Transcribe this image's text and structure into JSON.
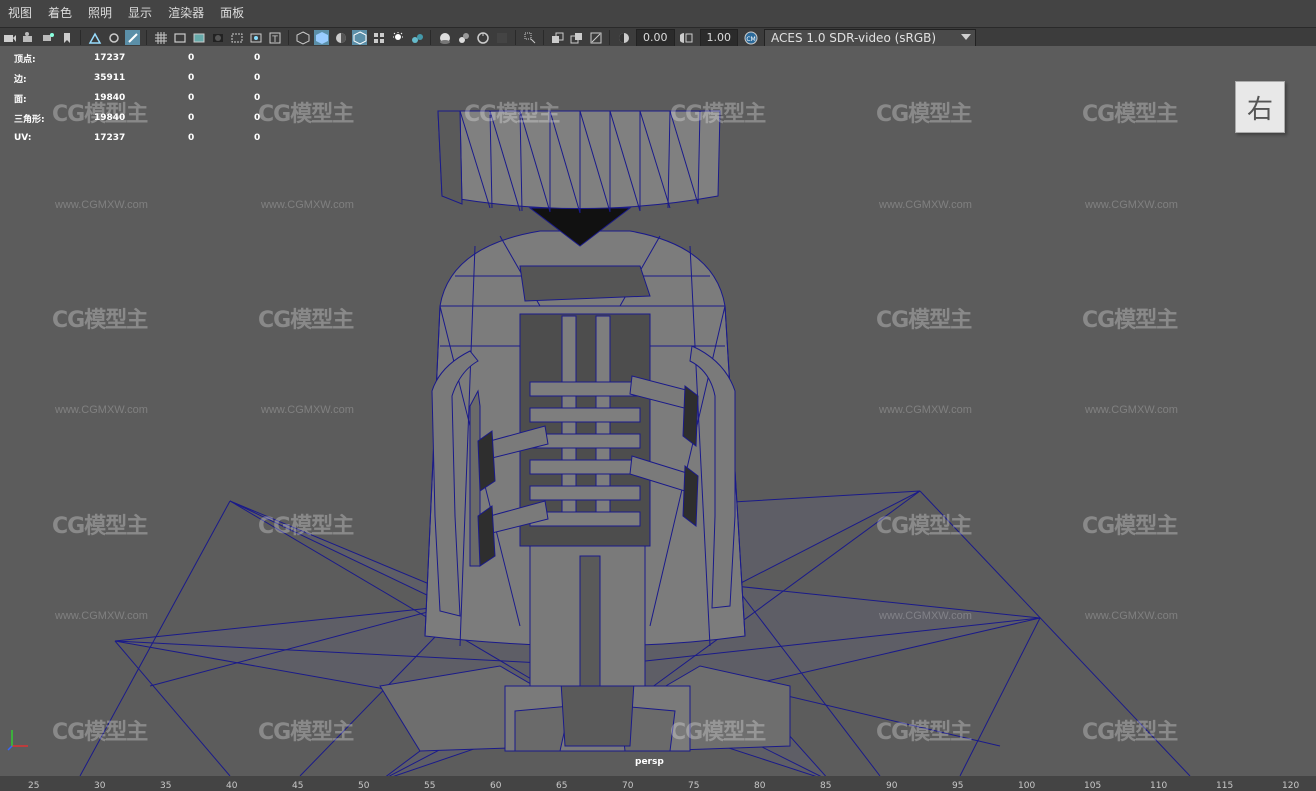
{
  "menu": [
    "视图",
    "着色",
    "照明",
    "显示",
    "渲染器",
    "面板"
  ],
  "toolbar": {
    "exposure_value": "0.00",
    "gamma_value": "1.00",
    "color_space": "ACES 1.0 SDR-video (sRGB)",
    "icons": [
      "camera-icon",
      "camera-attr-icon",
      "bookmark-icon",
      "image-plane-icon",
      "grid-icon",
      "film-gate-icon",
      "resolution-gate-icon",
      "gate-mask-icon",
      "field-chart-icon",
      "safe-action-icon",
      "safe-title-icon",
      "wireframe-icon",
      "smooth-shade-icon",
      "default-material-icon",
      "wireframe-on-shaded-icon",
      "textured-icon",
      "lights-icon",
      "shadows-icon",
      "ambient-occlusion-icon",
      "motion-blur-icon",
      "anti-alias-icon",
      "depth-of-field-icon",
      "isolate-select-icon",
      "xray-icon",
      "xray-joints-icon",
      "backface-icon",
      "exposure-icon",
      "gamma-icon",
      "color-mgmt-icon"
    ]
  },
  "hud": {
    "rows": [
      {
        "label": "顶点:",
        "value": "17237",
        "sel": "0",
        "comp": "0"
      },
      {
        "label": "边:",
        "value": "35911",
        "sel": "0",
        "comp": "0"
      },
      {
        "label": "面:",
        "value": "19840",
        "sel": "0",
        "comp": "0"
      },
      {
        "label": "三角形:",
        "value": "19840",
        "sel": "0",
        "comp": "0"
      },
      {
        "label": "UV:",
        "value": "17237",
        "sel": "0",
        "comp": "0"
      }
    ]
  },
  "viewcube_label": "右",
  "camera_label": "persp",
  "watermark": {
    "brand": "CG模型主",
    "url": "www.CGMXW.com"
  },
  "ruler_ticks": [
    "25",
    "30",
    "35",
    "40",
    "45",
    "50",
    "55",
    "60",
    "65",
    "70",
    "75",
    "80",
    "85",
    "90",
    "95",
    "100",
    "105",
    "110",
    "115",
    "120"
  ],
  "colors": {
    "wire": "#1a1a8a",
    "viewport": "#5c5c5c",
    "model_fill": "#7a7a7a"
  }
}
